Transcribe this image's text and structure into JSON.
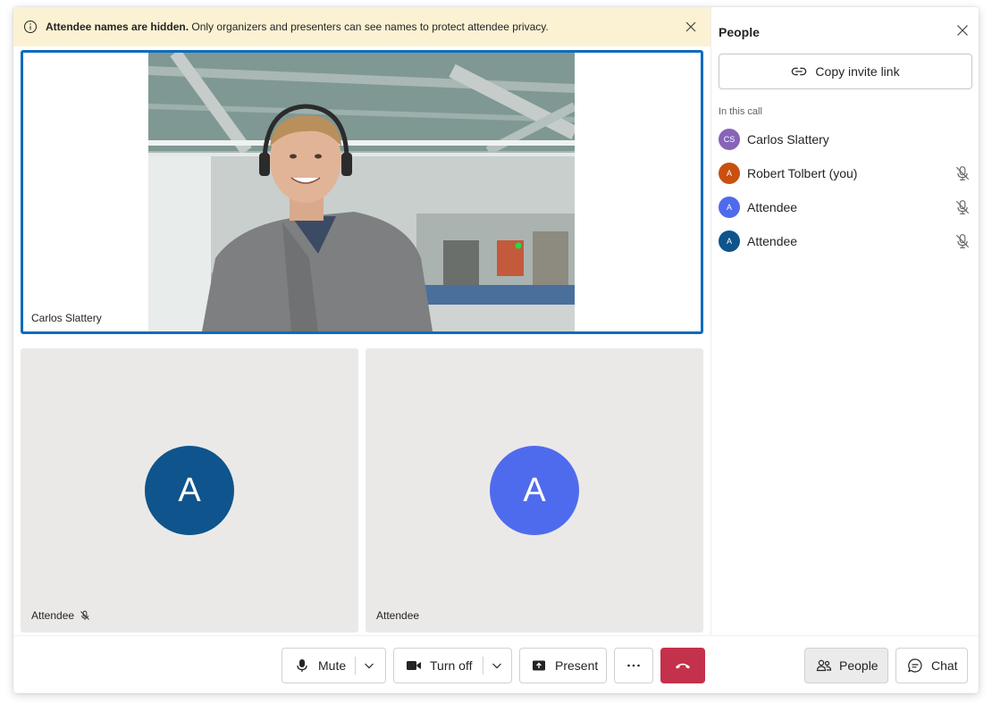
{
  "banner": {
    "bold_text": "Attendee names are hidden.",
    "text": " Only organizers and presenters can see names to protect attendee privacy."
  },
  "stage": {
    "main_video_name": "Carlos Slattery",
    "tiles": [
      {
        "name": "Attendee",
        "initial": "A",
        "color": "#0f548c",
        "muted": true
      },
      {
        "name": "Attendee",
        "initial": "A",
        "color": "#4f6bed",
        "muted": false
      }
    ]
  },
  "controls": {
    "mute_label": "Mute",
    "camera_label": "Turn off",
    "present_label": "Present",
    "people_label": "People",
    "chat_label": "Chat",
    "hangup_color": "#c4314b"
  },
  "people_pane": {
    "title": "People",
    "invite_label": "Copy invite link",
    "section_label": "In this call",
    "participants": [
      {
        "name": "Carlos Slattery",
        "initials": "CS",
        "color": "#8764b8",
        "muted": false
      },
      {
        "name": "Robert Tolbert (you)",
        "initials": "A",
        "color": "#ca5010",
        "muted": true
      },
      {
        "name": "Attendee",
        "initials": "A",
        "color": "#4f6bed",
        "muted": true
      },
      {
        "name": "Attendee",
        "initials": "A",
        "color": "#0f548c",
        "muted": true
      }
    ]
  },
  "colors": {
    "accent": "#0f6cbd",
    "banner_bg": "#fbf1d3",
    "tile_bg": "#ebe9e8"
  }
}
